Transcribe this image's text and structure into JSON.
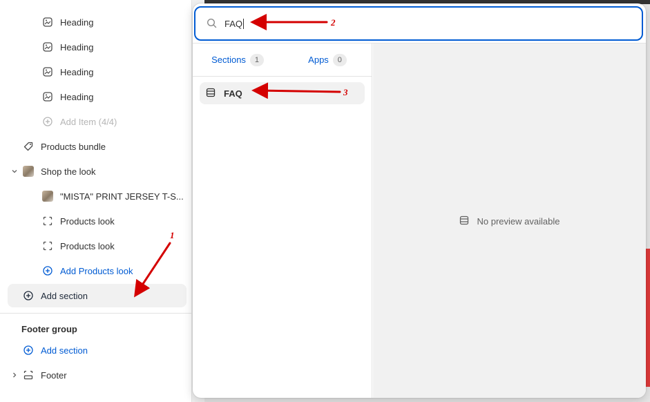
{
  "sidebar": {
    "items": [
      {
        "label": "Heading",
        "icon": "image-text-icon"
      },
      {
        "label": "Heading",
        "icon": "image-text-icon"
      },
      {
        "label": "Heading",
        "icon": "image-text-icon"
      },
      {
        "label": "Heading",
        "icon": "image-text-icon"
      },
      {
        "label": "Add Item (4/4)",
        "icon": "plus-circle-icon"
      },
      {
        "label": "Products bundle",
        "icon": "tag-icon"
      },
      {
        "label": "Shop the look",
        "icon": "product-thumbnail"
      },
      {
        "label": "\"MISTA\" PRINT JERSEY T-S...",
        "icon": "product-thumbnail"
      },
      {
        "label": "Products look",
        "icon": "focus-frame-icon"
      },
      {
        "label": "Products look",
        "icon": "focus-frame-icon"
      },
      {
        "label": "Add Products look",
        "icon": "plus-circle-icon"
      },
      {
        "label": "Add section",
        "icon": "plus-circle-icon"
      }
    ],
    "footer_group": {
      "title": "Footer group",
      "add_section": "Add section",
      "footer": "Footer"
    }
  },
  "search": {
    "value": "FAQ"
  },
  "tabs": [
    {
      "label": "Sections",
      "count": "1"
    },
    {
      "label": "Apps",
      "count": "0"
    }
  ],
  "results": [
    {
      "label": "FAQ",
      "icon": "section-list-icon"
    }
  ],
  "preview": {
    "empty_text": "No preview available"
  },
  "annotations": {
    "one": "1",
    "two": "2",
    "three": "3",
    "color": "#d40000"
  },
  "colors": {
    "accent": "#005bd3",
    "text": "#303030"
  }
}
